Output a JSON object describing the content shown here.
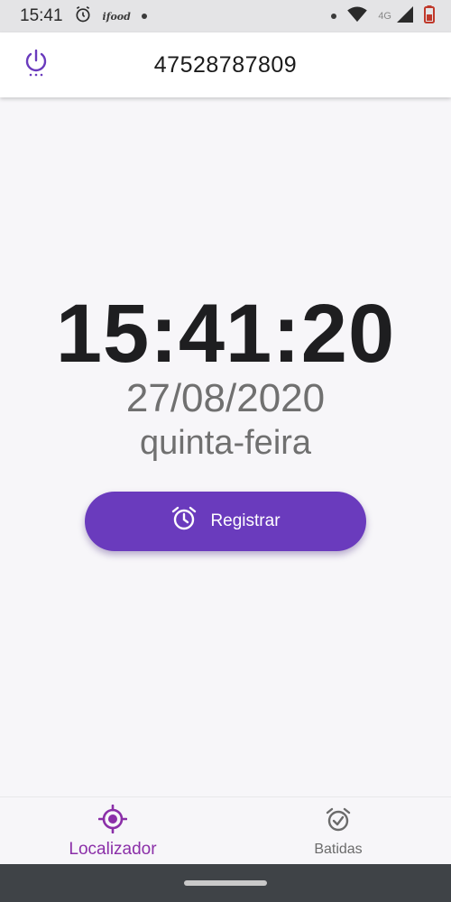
{
  "status_bar": {
    "time": "15:41",
    "app_label": "ifood",
    "network_label": "4G"
  },
  "app_bar": {
    "title": "47528787809",
    "power_icon": "power-icon"
  },
  "main": {
    "clock": "15:41:20",
    "date": "27/08/2020",
    "weekday": "quinta-feira",
    "register_label": "Registrar"
  },
  "bottom_nav": {
    "items": [
      {
        "label": "Localizador",
        "icon": "locator-icon",
        "active": true
      },
      {
        "label": "Batidas",
        "icon": "alarm-check-icon",
        "active": false
      }
    ]
  },
  "colors": {
    "primary": "#6a3bbd",
    "active_nav": "#8b2fa8",
    "inactive_nav": "#6b6b6b",
    "background": "#f7f6f9"
  }
}
